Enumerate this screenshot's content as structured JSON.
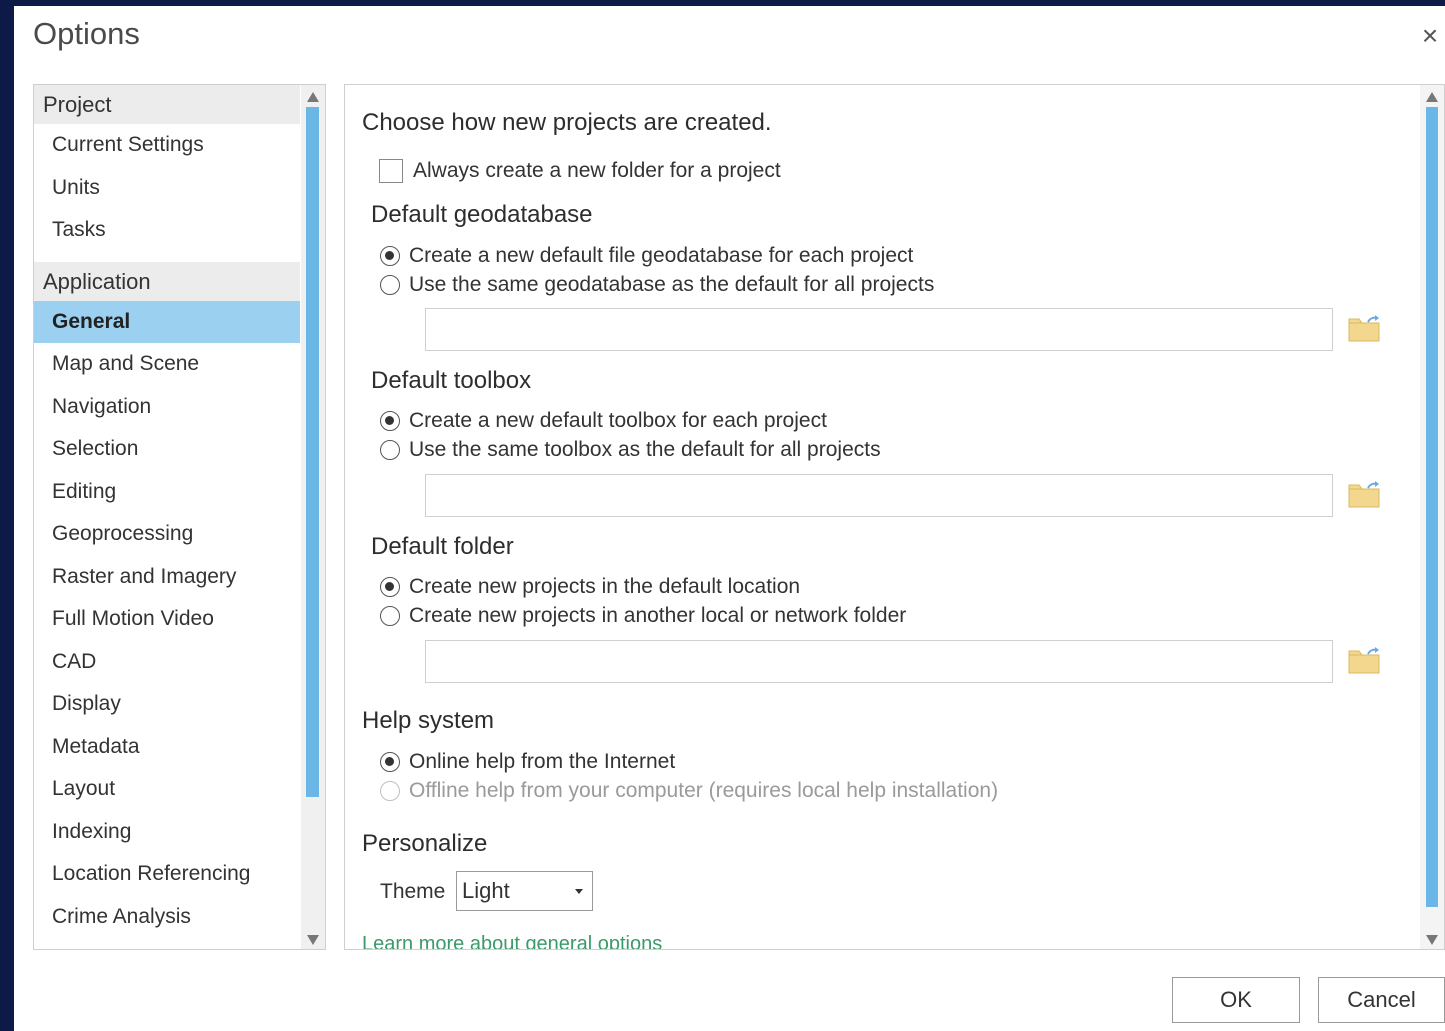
{
  "window": {
    "title": "Options",
    "close_glyph": "×"
  },
  "nav": {
    "groups": [
      {
        "label": "Project",
        "items": [
          "Current Settings",
          "Units",
          "Tasks"
        ]
      },
      {
        "label": "Application",
        "items": [
          "General",
          "Map and Scene",
          "Navigation",
          "Selection",
          "Editing",
          "Geoprocessing",
          "Raster and Imagery",
          "Full Motion Video",
          "CAD",
          "Display",
          "Metadata",
          "Layout",
          "Indexing",
          "Location Referencing",
          "Crime Analysis"
        ]
      }
    ],
    "selected": "General"
  },
  "main": {
    "intro_heading": "Choose how new projects are created.",
    "new_folder_checkbox": {
      "label": "Always create a new folder for a project",
      "checked": false
    },
    "geodatabase": {
      "heading": "Default geodatabase",
      "option1": "Create a new default file geodatabase for each project",
      "option2": "Use the same geodatabase as the default for all projects",
      "path_value": ""
    },
    "toolbox": {
      "heading": "Default toolbox",
      "option1": "Create a new default toolbox for each project",
      "option2": "Use the same toolbox as the default for all projects",
      "path_value": ""
    },
    "folder": {
      "heading": "Default folder",
      "option1": "Create new projects in the default location",
      "option2": "Create new projects in another local or network folder",
      "path_value": ""
    },
    "help": {
      "heading": "Help system",
      "option1": "Online help from the Internet",
      "option2": "Offline help from your computer (requires local help installation)"
    },
    "personalize": {
      "heading": "Personalize",
      "theme_label": "Theme",
      "theme_value": "Light"
    },
    "learn_more": "Learn more about general options"
  },
  "footer": {
    "ok_label": "OK",
    "cancel_label": "Cancel"
  },
  "colors": {
    "accent": "#69b6e7",
    "selection": "#9bd0f0",
    "link": "#3a9a6a",
    "folder_icon": "#f3d78e"
  },
  "icons": [
    "close-icon",
    "folder-open-icon",
    "chevron-down-icon",
    "scroll-up-icon",
    "scroll-down-icon"
  ]
}
